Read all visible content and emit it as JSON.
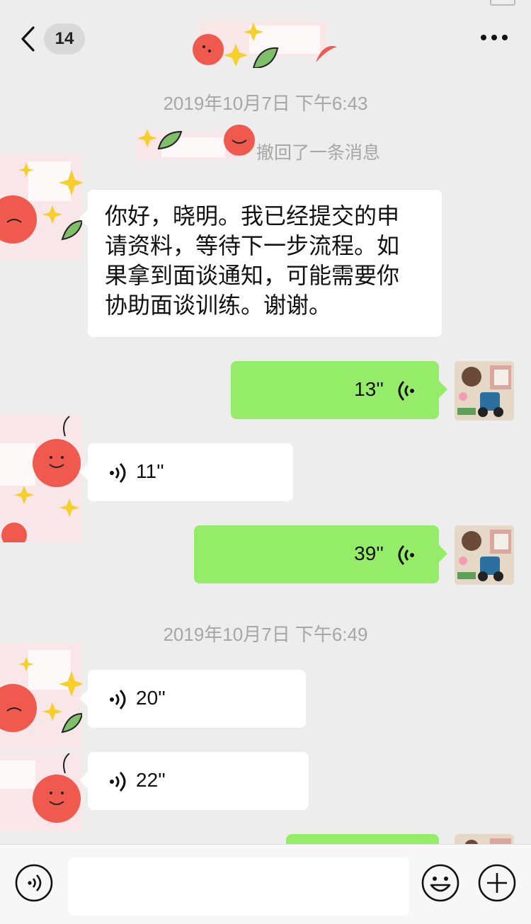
{
  "header": {
    "unread_count": "14",
    "back_icon": "chevron-left-icon",
    "more_icon": "more-dots-icon"
  },
  "timestamps": [
    "2019年10月7日 下午6:43",
    "2019年10月7日 下午6:49"
  ],
  "system": {
    "recall_text": "撤回了一条消息"
  },
  "messages": [
    {
      "sender": "them",
      "type": "text",
      "text": "你好，晓明。我已经提交的申\n请资料，等待下一步流程。如\n果拿到面谈通知，可能需要你\n协助面谈训练。谢谢。"
    },
    {
      "sender": "me",
      "type": "voice",
      "duration": "13''"
    },
    {
      "sender": "them",
      "type": "voice",
      "duration": "11''"
    },
    {
      "sender": "me",
      "type": "voice",
      "duration": "39''"
    },
    {
      "sender": "them",
      "type": "voice",
      "duration": "20''"
    },
    {
      "sender": "them",
      "type": "voice",
      "duration": "22''"
    },
    {
      "sender": "me",
      "type": "voice",
      "duration": ""
    }
  ],
  "input_bar": {
    "voice_icon": "voice-mode-icon",
    "emoji_icon": "emoji-icon",
    "plus_icon": "plus-icon",
    "input_value": ""
  },
  "colors": {
    "background": "#ededed",
    "bubble_out": "#95ec69",
    "bubble_in": "#ffffff",
    "timestamp": "#a6a6a6"
  }
}
